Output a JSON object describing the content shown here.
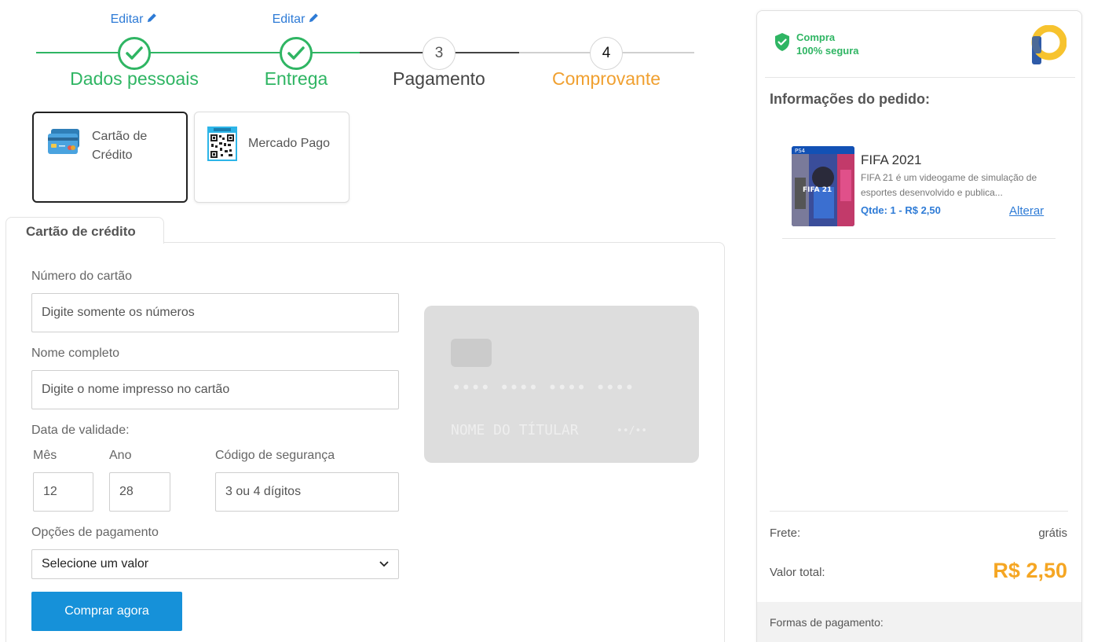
{
  "stepper": {
    "steps": [
      {
        "label": "Dados pessoais",
        "edit": "Editar",
        "status": "done",
        "color": "#2fb563"
      },
      {
        "label": "Entrega",
        "edit": "Editar",
        "status": "done",
        "color": "#2fb563"
      },
      {
        "label": "Pagamento",
        "number": "3",
        "status": "current",
        "color": "#444444"
      },
      {
        "label": "Comprovante",
        "number": "4",
        "status": "pending",
        "color": "#f0a030"
      }
    ]
  },
  "methods": [
    {
      "label": "Cartão de Crédito",
      "icon": "credit-card-icon",
      "selected": true
    },
    {
      "label": "Mercado Pago",
      "icon": "qr-code-icon",
      "selected": false
    }
  ],
  "form": {
    "tab_label": "Cartão de crédito",
    "card_number_label": "Número do cartão",
    "card_number_placeholder": "Digite somente os números",
    "name_label": "Nome completo",
    "name_placeholder": "Digite o nome impresso no cartão",
    "validity_label": "Data de validade:",
    "month_label": "Mês",
    "month_value": "12",
    "year_label": "Ano",
    "year_value": "28",
    "cvv_label": "Código de segurança",
    "cvv_placeholder": "3 ou 4 dígitos",
    "options_label": "Opções de pagamento",
    "options_selected": "Selecione um valor",
    "buy_button": "Comprar agora"
  },
  "card_preview": {
    "number": "•••• •••• •••• ••••",
    "holder": "NOME DO TÍTULAR",
    "validity": "••/••"
  },
  "summary": {
    "secure_line1": "Compra",
    "secure_line2": "100% segura",
    "title": "Informações do pedido:",
    "product": {
      "name": "FIFA 2021",
      "description": "FIFA 21 é um videogame de simulação de esportes desenvolvido e publica...",
      "qty": "Qtde: 1 - R$ 2,50",
      "alter": "Alterar"
    },
    "frete_label": "Frete:",
    "frete_value": "grátis",
    "total_label": "Valor total:",
    "total_value": "R$ 2,50",
    "payment_forms": "Formas de pagamento:"
  },
  "colors": {
    "green": "#2fb563",
    "blue": "#2e7bd6",
    "button": "#1691d9",
    "orange": "#f5a623"
  }
}
